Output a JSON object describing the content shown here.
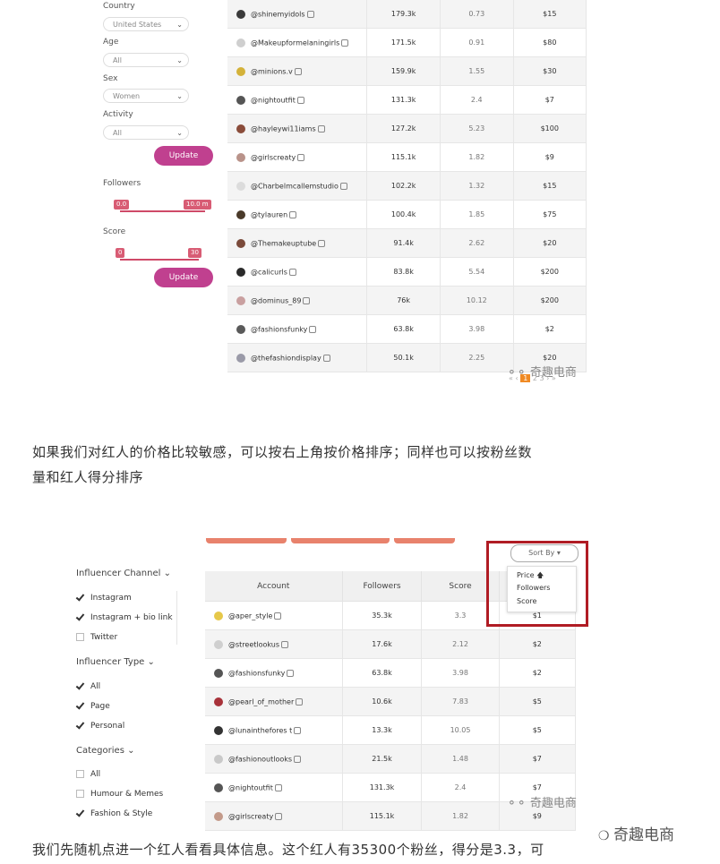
{
  "filters": {
    "country": {
      "label": "Country",
      "value": "United States"
    },
    "age": {
      "label": "Age",
      "value": "All"
    },
    "sex": {
      "label": "Sex",
      "value": "Women"
    },
    "activity": {
      "label": "Activity",
      "value": "All"
    },
    "update_label": "Update",
    "followers": {
      "label": "Followers",
      "min": "0.0",
      "max": "10.0 m"
    },
    "score": {
      "label": "Score",
      "min": "0",
      "max": "30"
    },
    "update2_label": "Update"
  },
  "table1": {
    "rows": [
      {
        "account": "@shinemyidols",
        "followers": "179.3k",
        "score": "0.73",
        "price": "$15"
      },
      {
        "account": "@Makeupformelaningirls",
        "followers": "171.5k",
        "score": "0.91",
        "price": "$80"
      },
      {
        "account": "@minions.v",
        "followers": "159.9k",
        "score": "1.55",
        "price": "$30"
      },
      {
        "account": "@nightoutfit",
        "followers": "131.3k",
        "score": "2.4",
        "price": "$7"
      },
      {
        "account": "@hayleywi11iams",
        "followers": "127.2k",
        "score": "5.23",
        "price": "$100"
      },
      {
        "account": "@girlscreaty",
        "followers": "115.1k",
        "score": "1.82",
        "price": "$9"
      },
      {
        "account": "@Charbelmcallemstudio",
        "followers": "102.2k",
        "score": "1.32",
        "price": "$15"
      },
      {
        "account": "@tylauren",
        "followers": "100.4k",
        "score": "1.85",
        "price": "$75"
      },
      {
        "account": "@Themakeuptube",
        "followers": "91.4k",
        "score": "2.62",
        "price": "$20"
      },
      {
        "account": "@calicurls",
        "followers": "83.8k",
        "score": "5.54",
        "price": "$200"
      },
      {
        "account": "@dominus_89",
        "followers": "76k",
        "score": "10.12",
        "price": "$200"
      },
      {
        "account": "@fashionsfunky",
        "followers": "63.8k",
        "score": "3.98",
        "price": "$2"
      },
      {
        "account": "@thefashiondisplay",
        "followers": "50.1k",
        "score": "2.25",
        "price": "$20"
      }
    ],
    "pagination": {
      "prev": "« ‹",
      "current": "1",
      "pages": "2  3",
      "next": "› »"
    }
  },
  "watermark": "奇趣电商",
  "paragraph1_line1": "如果我们对红人的价格比较敏感，可以按右上角按价格排序；同样也可以按粉丝数",
  "paragraph1_line2": "量和红人得分排序",
  "sidebar2": {
    "channel_heading": "Influencer Channel ⌄",
    "channel_items": [
      {
        "label": "Instagram",
        "checked": true
      },
      {
        "label": "Instagram + bio link",
        "checked": true
      },
      {
        "label": "Twitter",
        "checked": false
      }
    ],
    "type_heading": "Influencer Type ⌄",
    "type_items": [
      {
        "label": "All",
        "checked": true
      },
      {
        "label": "Page",
        "checked": true
      },
      {
        "label": "Personal",
        "checked": true
      }
    ],
    "categories_heading": "Categories ⌄",
    "category_items": [
      {
        "label": "All",
        "checked": false
      },
      {
        "label": "Humour & Memes",
        "checked": false
      },
      {
        "label": "Fashion & Style",
        "checked": true
      }
    ]
  },
  "sort": {
    "button_label": "Sort By ▾",
    "options": [
      "Price",
      "Followers",
      "Score"
    ],
    "price_arrow": "🡅"
  },
  "table2": {
    "headers": {
      "account": "Account",
      "followers": "Followers",
      "score": "Score"
    },
    "rows": [
      {
        "account": "@aper_style",
        "followers": "35.3k",
        "score": "3.3",
        "price": "$1"
      },
      {
        "account": "@streetlookus",
        "followers": "17.6k",
        "score": "2.12",
        "price": "$2"
      },
      {
        "account": "@fashionsfunky",
        "followers": "63.8k",
        "score": "3.98",
        "price": "$2"
      },
      {
        "account": "@pearl_of_mother",
        "followers": "10.6k",
        "score": "7.83",
        "price": "$5"
      },
      {
        "account": "@lunainthefores t",
        "followers": "13.3k",
        "score": "10.05",
        "price": "$5"
      },
      {
        "account": "@fashionoutlooks",
        "followers": "21.5k",
        "score": "1.48",
        "price": "$7"
      },
      {
        "account": "@nightoutfit",
        "followers": "131.3k",
        "score": "2.4",
        "price": "$7"
      },
      {
        "account": "@girlscreaty",
        "followers": "115.1k",
        "score": "1.82",
        "price": "$9"
      }
    ]
  },
  "wechat_watermark": "奇趣电商",
  "paragraph2": "我们先随机点进一个红人看看具体信息。这个红人有35300个粉丝，得分是3.3，可",
  "colors": {
    "accent": "#c0408f",
    "range": "#d85c74",
    "highlight_box": "#b01c24"
  }
}
